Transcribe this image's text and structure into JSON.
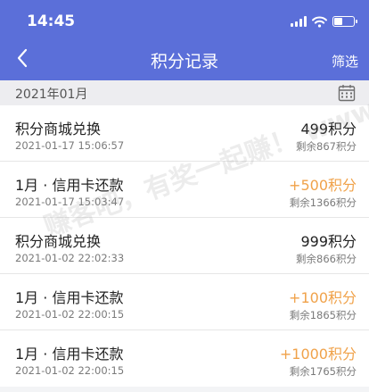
{
  "status_bar": {
    "time": "14:45"
  },
  "nav": {
    "title": "积分记录",
    "filter_label": "筛选"
  },
  "month": {
    "label": "2021年01月"
  },
  "records": [
    {
      "title": "积分商城兑换",
      "time": "2021-01-17 15:06:57",
      "points": "499积分",
      "balance": "剩余867积分",
      "type": "deduct"
    },
    {
      "title": "1月 · 信用卡还款",
      "time": "2021-01-17 15:03:47",
      "points": "+500积分",
      "balance": "剩余1366积分",
      "type": "earn"
    },
    {
      "title": "积分商城兑换",
      "time": "2021-01-02 22:02:33",
      "points": "999积分",
      "balance": "剩余866积分",
      "type": "deduct"
    },
    {
      "title": "1月 · 信用卡还款",
      "time": "2021-01-02 22:00:15",
      "points": "+100积分",
      "balance": "剩余1865积分",
      "type": "earn"
    },
    {
      "title": "1月 · 信用卡还款",
      "time": "2021-01-02 22:00:15",
      "points": "+1000积分",
      "balance": "剩余1765积分",
      "type": "earn"
    }
  ],
  "watermark": "赚客吧，有奖一起赚！ www.zuanke8.com",
  "colors": {
    "header": "#5b6fd9",
    "earn": "#f0a24a",
    "text": "#222222",
    "muted": "#7a7a7a"
  },
  "icons": {
    "back": "chevron-left-icon",
    "calendar": "calendar-icon",
    "wifi": "wifi-icon",
    "battery": "battery-icon",
    "signal": "signal-icon"
  }
}
